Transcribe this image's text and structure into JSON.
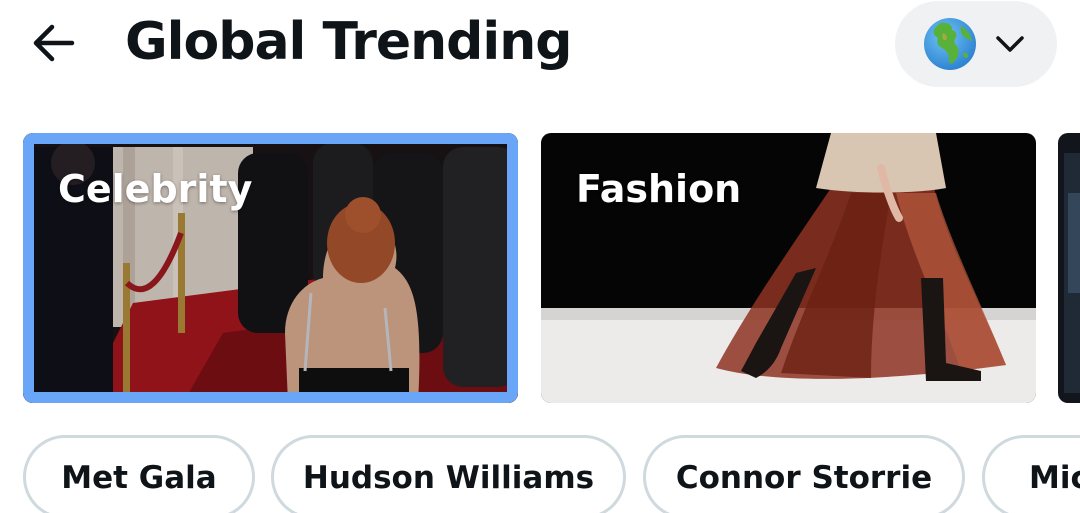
{
  "header": {
    "title": "Global Trending",
    "back_icon": "arrow-left-icon",
    "region_icon": "globe-icon",
    "dropdown_icon": "chevron-down-icon"
  },
  "categories": [
    {
      "label": "Celebrity",
      "selected": true
    },
    {
      "label": "Fashion",
      "selected": false
    }
  ],
  "chips": [
    {
      "label": "Met Gala"
    },
    {
      "label": "Hudson Williams"
    },
    {
      "label": "Connor Storrie"
    },
    {
      "label": "Mic"
    }
  ],
  "colors": {
    "selected_border": "#6aa6f8",
    "chip_border": "#cfd9de",
    "region_bg": "#eff1f3",
    "text": "#0f1419"
  }
}
